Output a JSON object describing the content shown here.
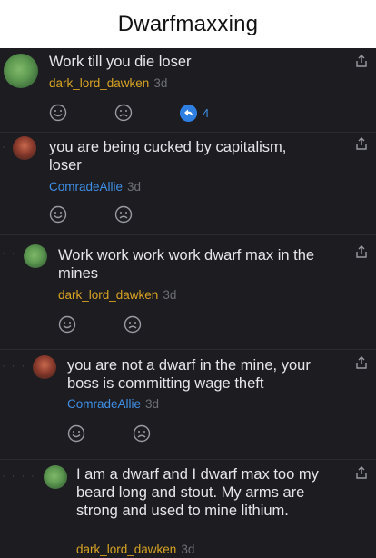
{
  "header": {
    "title": "Dwarfmaxxing"
  },
  "comments": [
    {
      "text": "Work till you die loser",
      "user": "dark_lord_dawken",
      "time": "3d",
      "reply_count": "4"
    },
    {
      "text": "you are being cucked by capitalism, loser",
      "user": "ComradeAllie",
      "time": "3d"
    },
    {
      "text": "Work work work work dwarf max in the mines",
      "user": "dark_lord_dawken",
      "time": "3d"
    },
    {
      "text": "you are not a dwarf in the mine, your boss is committing wage theft",
      "user": "ComradeAllie",
      "time": "3d"
    },
    {
      "text": "I am a dwarf and I dwarf max too my beard long and stout. My arms are strong and used to mine lithium.",
      "user": "dark_lord_dawken",
      "time": "3d"
    }
  ],
  "colors": {
    "username_gold": "#d8a323",
    "username_blue": "#3f8fe6",
    "background": "#1c1c21"
  }
}
